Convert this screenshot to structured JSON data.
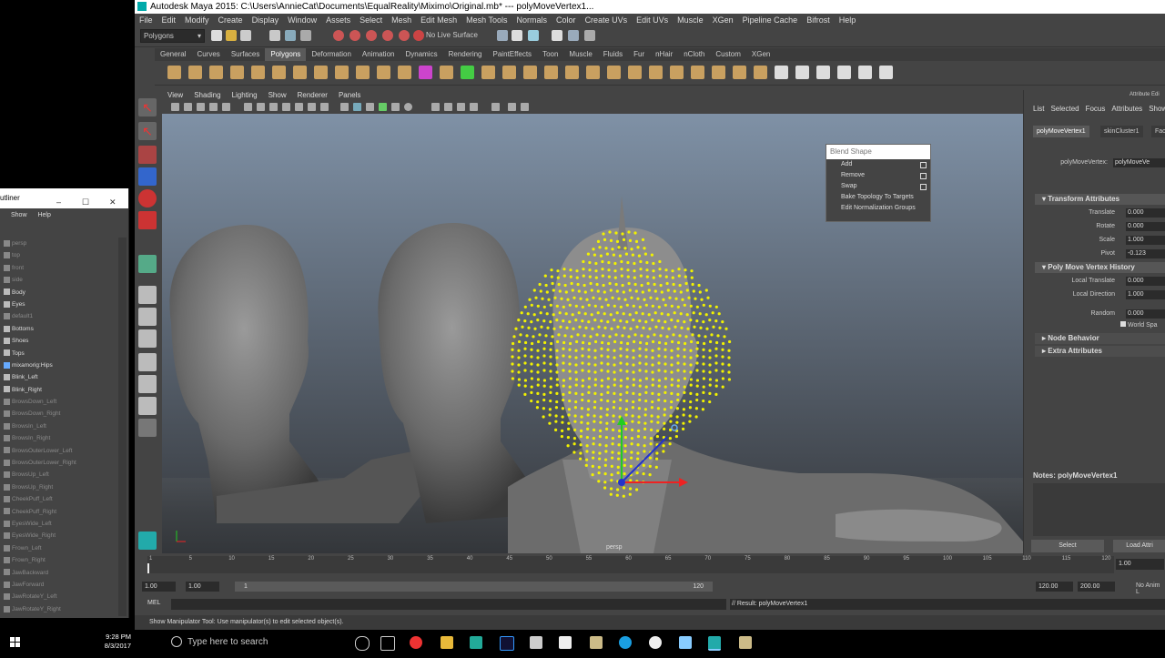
{
  "window": {
    "title": "Autodesk Maya 2015: C:\\Users\\AnnieCat\\Documents\\EqualReality\\Miximo\\Original.mb*   ---   polyMoveVertex1..."
  },
  "menu": [
    "File",
    "Edit",
    "Modify",
    "Create",
    "Display",
    "Window",
    "Assets",
    "Select",
    "Mesh",
    "Edit Mesh",
    "Mesh Tools",
    "Normals",
    "Color",
    "Create UVs",
    "Edit UVs",
    "Muscle",
    "XGen",
    "Pipeline Cache",
    "Bifrost",
    "Help"
  ],
  "status_line": {
    "mode": "Polygons",
    "live_surface": "No Live Surface"
  },
  "shelf_tabs": {
    "items": [
      "General",
      "Curves",
      "Surfaces",
      "Polygons",
      "Deformation",
      "Animation",
      "Dynamics",
      "Rendering",
      "PaintEffects",
      "Toon",
      "Muscle",
      "Fluids",
      "Fur",
      "nHair",
      "nCloth",
      "Custom",
      "XGen"
    ],
    "active": "Polygons"
  },
  "panel_menu": [
    "View",
    "Shading",
    "Lighting",
    "Show",
    "Renderer",
    "Panels"
  ],
  "viewport": {
    "camera_label": "persp"
  },
  "blend_shape": {
    "title": "Blend Shape",
    "items": [
      "Add",
      "Remove",
      "Swap",
      "Bake Topology To Targets",
      "Edit Normalization Groups"
    ]
  },
  "attribute_editor": {
    "title": "Attribute Edi",
    "menu": [
      "List",
      "Selected",
      "Focus",
      "Attributes",
      "Show"
    ],
    "tabs": [
      "polyMoveVertex1",
      "skinCluster1",
      "Faci"
    ],
    "node_label": "polyMoveVertex:",
    "node_value": "polyMoveVe",
    "section_transform": "Transform Attributes",
    "translate_label": "Translate",
    "translate_value": "0.000",
    "rotate_label": "Rotate",
    "rotate_value": "0.000",
    "scale_label": "Scale",
    "scale_value": "1.000",
    "pivot_label": "Pivot",
    "pivot_value": "-0.123",
    "section_history": "Poly Move Vertex History",
    "local_translate_label": "Local Translate",
    "local_translate_value": "0.000",
    "local_direction_label": "Local Direction",
    "local_direction_value": "1.000",
    "random_label": "Random",
    "random_value": "0.000",
    "world_space_label": "World Spa",
    "section_node": "Node Behavior",
    "section_extra": "Extra Attributes",
    "notes_label": "Notes: polyMoveVertex1",
    "select_button": "Select",
    "load_button": "Load Attri"
  },
  "time_slider": {
    "ticks": [
      "1",
      "5",
      "10",
      "15",
      "20",
      "25",
      "30",
      "35",
      "40",
      "45",
      "50",
      "55",
      "60",
      "65",
      "70",
      "75",
      "80",
      "85",
      "90",
      "95",
      "100",
      "105",
      "110",
      "115",
      "120"
    ],
    "current_frame": "1.00"
  },
  "range_slider": {
    "start": "1.00",
    "start2": "1.00",
    "inner_start": "1",
    "inner_end": "120",
    "end": "120.00",
    "end2": "200.00",
    "anim_layer": "No Anim L"
  },
  "command_line": {
    "label": "MEL",
    "result": "// Result: polyMoveVertex1"
  },
  "help_line": {
    "text": "Show Manipulator Tool: Use manipulator(s) to edit selected object(s)."
  },
  "outliner": {
    "title": "utliner",
    "menu": [
      "Show",
      "Help"
    ],
    "items": [
      {
        "label": "persp",
        "dim": true
      },
      {
        "label": "top",
        "dim": true
      },
      {
        "label": "front",
        "dim": true
      },
      {
        "label": "side",
        "dim": true
      },
      {
        "label": "Body",
        "dim": false
      },
      {
        "label": "Eyes",
        "dim": false
      },
      {
        "label": "default1",
        "dim": true
      },
      {
        "label": "Bottoms",
        "dim": false
      },
      {
        "label": "Shoes",
        "dim": false
      },
      {
        "label": "Tops",
        "dim": false
      },
      {
        "label": "mixamorig:Hips",
        "dim": false
      },
      {
        "label": "Blink_Left",
        "dim": false
      },
      {
        "label": "Blink_Right",
        "dim": false
      },
      {
        "label": "BrowsDown_Left",
        "dim": true
      },
      {
        "label": "BrowsDown_Right",
        "dim": true
      },
      {
        "label": "BrowsIn_Left",
        "dim": true
      },
      {
        "label": "BrowsIn_Right",
        "dim": true
      },
      {
        "label": "BrowsOuterLower_Left",
        "dim": true
      },
      {
        "label": "BrowsOuterLower_Right",
        "dim": true
      },
      {
        "label": "BrowsUp_Left",
        "dim": true
      },
      {
        "label": "BrowsUp_Right",
        "dim": true
      },
      {
        "label": "CheekPuff_Left",
        "dim": true
      },
      {
        "label": "CheekPuff_Right",
        "dim": true
      },
      {
        "label": "EyesWide_Left",
        "dim": true
      },
      {
        "label": "EyesWide_Right",
        "dim": true
      },
      {
        "label": "Frown_Left",
        "dim": true
      },
      {
        "label": "Frown_Right",
        "dim": true
      },
      {
        "label": "JawBackward",
        "dim": true
      },
      {
        "label": "JawForward",
        "dim": true
      },
      {
        "label": "JawRotateY_Left",
        "dim": true
      },
      {
        "label": "JawRotateY_Right",
        "dim": true
      }
    ]
  },
  "taskbar": {
    "search_placeholder": "Type here to search",
    "time": "9:28 PM",
    "date": "8/3/2017"
  },
  "colors": {
    "accent": "#5a5a5a",
    "selection": "#ffff00"
  }
}
